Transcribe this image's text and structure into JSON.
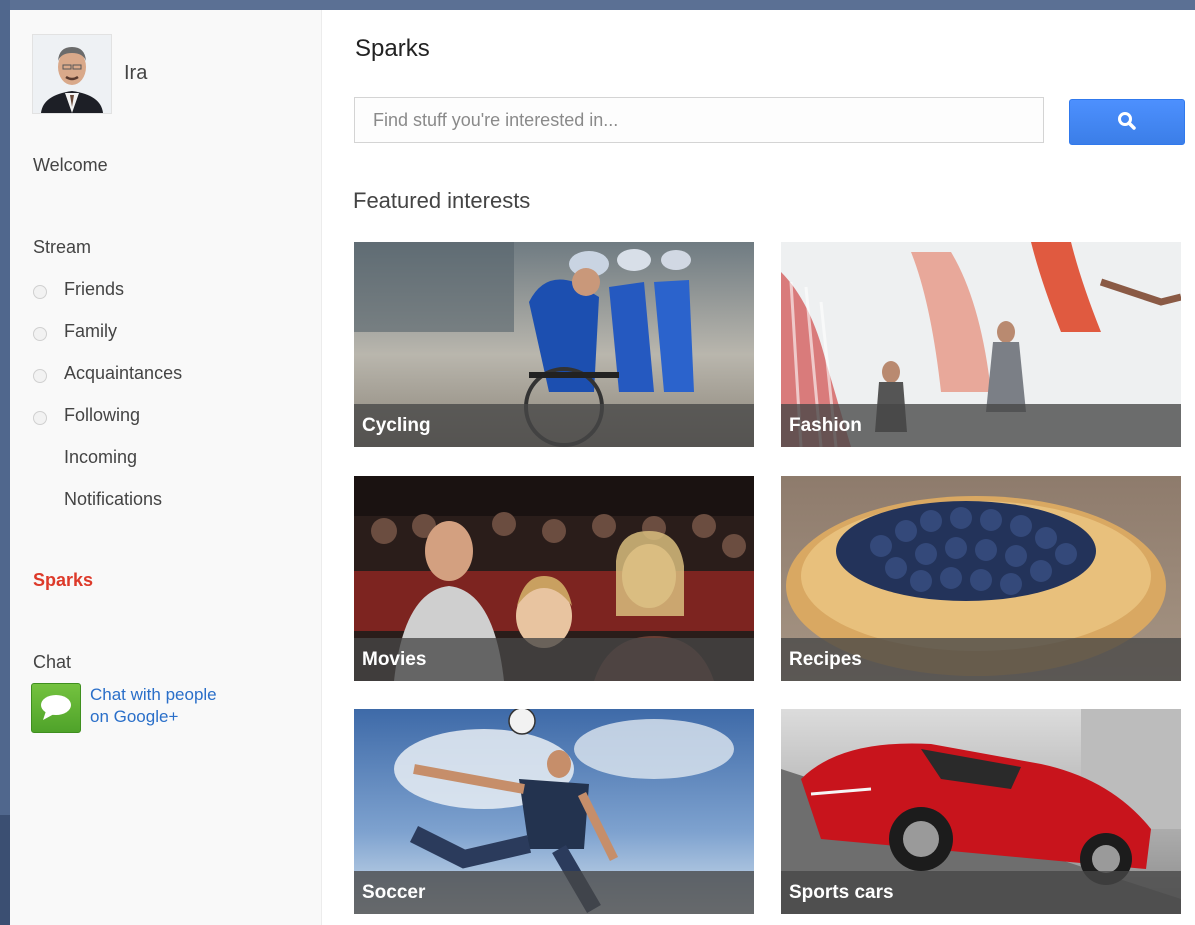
{
  "profile": {
    "name": "Ira"
  },
  "sidebar": {
    "welcome": "Welcome",
    "stream": "Stream",
    "circles": [
      {
        "label": "Friends"
      },
      {
        "label": "Family"
      },
      {
        "label": "Acquaintances"
      },
      {
        "label": "Following"
      }
    ],
    "incoming": "Incoming",
    "notifications": "Notifications",
    "sparks": "Sparks",
    "chat_heading": "Chat",
    "chat_link_line1": "Chat with people",
    "chat_link_line2": "on Google+",
    "active_color": "#dd3a2a",
    "link_color": "#2a6fc9"
  },
  "main": {
    "title": "Sparks",
    "search": {
      "placeholder": "Find stuff you're interested in...",
      "value": ""
    },
    "search_button_icon": "search-icon",
    "accent_color": "#4d90fe",
    "featured_title": "Featured interests",
    "interests": [
      {
        "label": "Cycling"
      },
      {
        "label": "Fashion"
      },
      {
        "label": "Movies"
      },
      {
        "label": "Recipes"
      },
      {
        "label": "Soccer"
      },
      {
        "label": "Sports cars"
      }
    ]
  }
}
